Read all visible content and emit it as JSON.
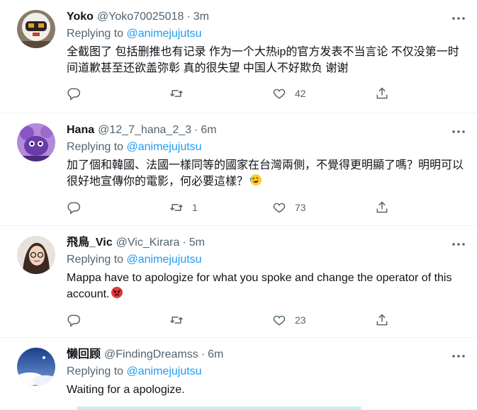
{
  "colors": {
    "accent": "#1d9bf0",
    "muted": "#536471",
    "text": "#0f1419",
    "divider": "#eff3f4"
  },
  "tweets": [
    {
      "name": "Yoko",
      "handle": "@Yoko70025018",
      "dot": "·",
      "time": "3m",
      "reply_prefix": "Replying to",
      "reply_to": "@animejujutsu",
      "text": "全截图了 包括删推也有记录 作为一个大热ip的官方发表不当言论 不仅没第一时间道歉甚至还欲盖弥彰 真的很失望 中国人不好欺负 谢谢",
      "reply_count": "",
      "retweet_count": "",
      "like_count": "42",
      "avatar_icon": "helmet-avatar"
    },
    {
      "name": "Hana",
      "handle": "@12_7_hana_2_3",
      "dot": "·",
      "time": "6m",
      "reply_prefix": "Replying to",
      "reply_to": "@animejujutsu",
      "text": "加了個和韓國、法國一樣同等的國家在台灣兩側，不覺得更明顯了嗎？明明可以很好地宣傳你的電影，何必要這樣？",
      "emoji": "rolling-on-floor-laughing",
      "reply_count": "",
      "retweet_count": "1",
      "like_count": "73",
      "avatar_icon": "purple-character-avatar"
    },
    {
      "name": "飛鳥_Vic",
      "handle": "@Vic_Kirara",
      "dot": "·",
      "time": "5m",
      "reply_prefix": "Replying to",
      "reply_to": "@animejujutsu",
      "text": "Mappa have to apologize for what you spoke and change the operator of this account.",
      "emoji": "angry-face",
      "reply_count": "",
      "retweet_count": "",
      "like_count": "23",
      "avatar_icon": "photo-avatar"
    },
    {
      "name": "懒回顾",
      "handle": "@FindingDreamss",
      "dot": "·",
      "time": "6m",
      "reply_prefix": "Replying to",
      "reply_to": "@animejujutsu",
      "text": "Waiting for a apologize.",
      "avatar_icon": "sky-avatar"
    }
  ]
}
